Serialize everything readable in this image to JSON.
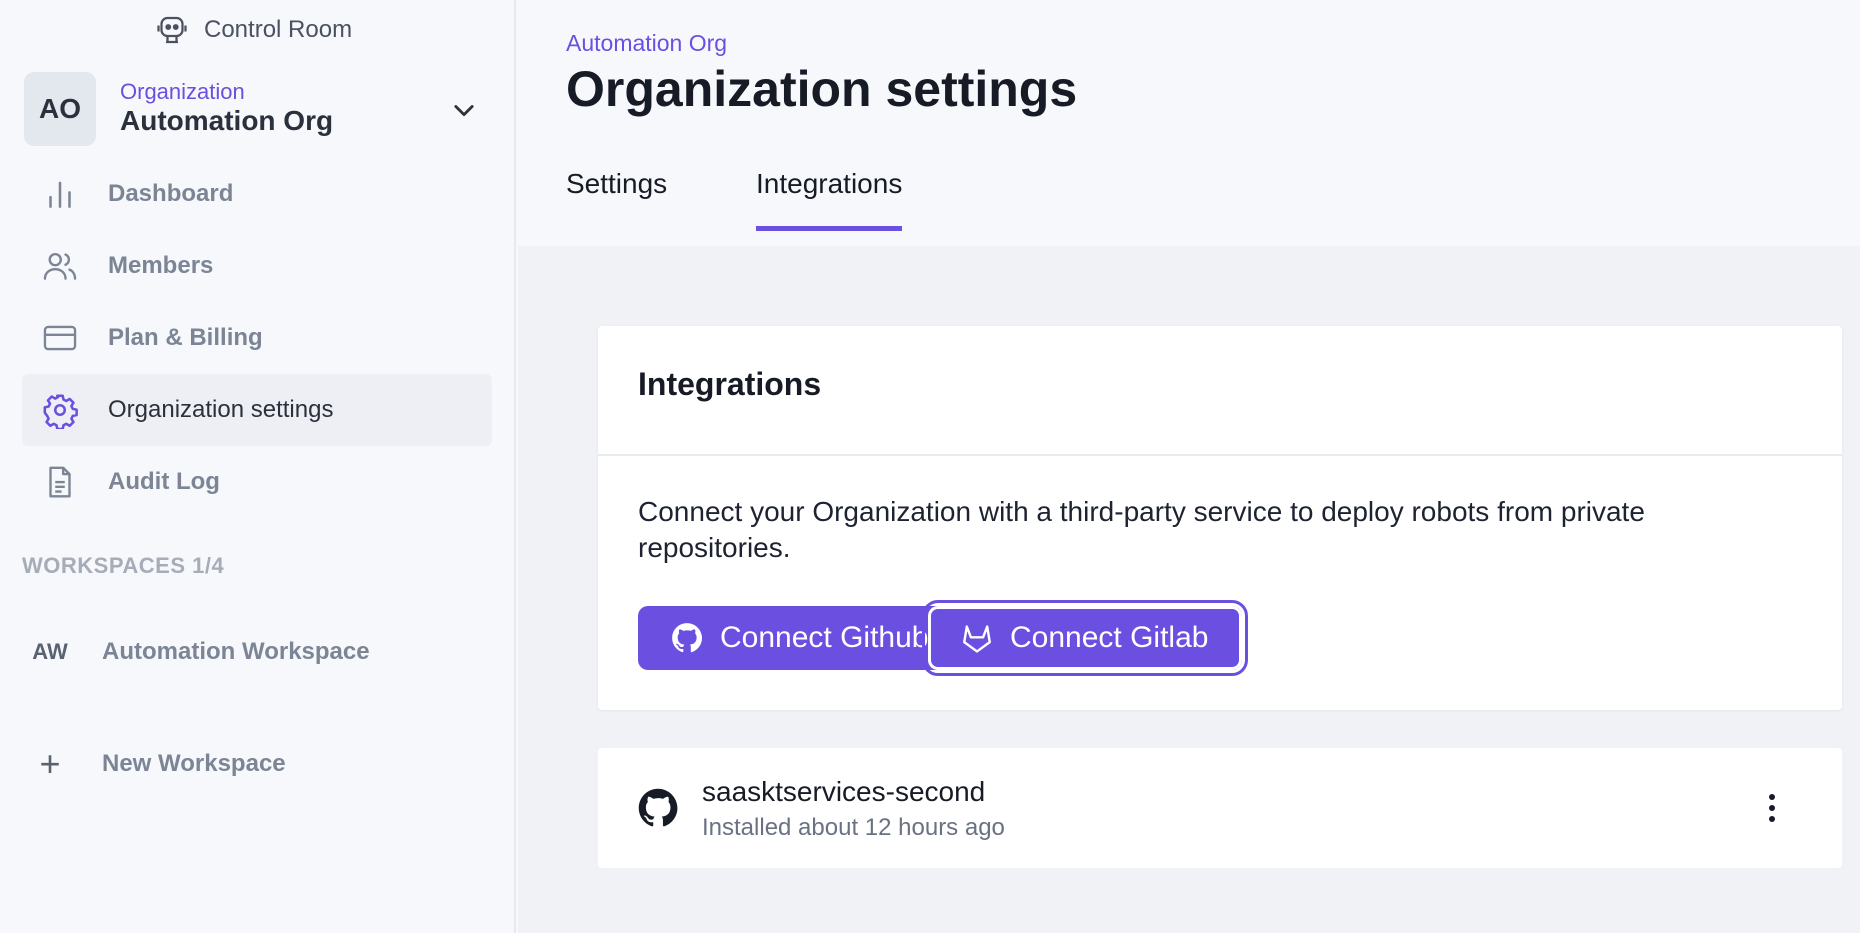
{
  "app": {
    "brand": "Control Room",
    "brand_icon": "robot-icon"
  },
  "org": {
    "avatar_initials": "AO",
    "kicker": "Organization",
    "name": "Automation Org"
  },
  "sidebar": {
    "items": [
      {
        "label": "Dashboard",
        "icon": "bar-chart-icon"
      },
      {
        "label": "Members",
        "icon": "users-icon"
      },
      {
        "label": "Plan & Billing",
        "icon": "credit-card-icon"
      },
      {
        "label": "Organization settings",
        "icon": "gear-icon"
      },
      {
        "label": "Audit Log",
        "icon": "document-icon"
      }
    ],
    "active_item": "Organization settings",
    "workspaces_title": "WORKSPACES 1/4",
    "workspaces": [
      {
        "abbr": "AW",
        "name": "Automation Workspace"
      }
    ],
    "new_workspace_label": "New Workspace"
  },
  "header": {
    "breadcrumb": "Automation Org",
    "title": "Organization settings",
    "tabs": [
      {
        "label": "Settings"
      },
      {
        "label": "Integrations"
      }
    ],
    "active_tab": "Integrations"
  },
  "integrations": {
    "title": "Integrations",
    "description": "Connect your Organization with a third-party service to deploy robots from private repositories.",
    "buttons": {
      "github": "Connect Github",
      "gitlab": "Connect Gitlab"
    },
    "connections": [
      {
        "name": "saasktservices-second",
        "status": "Installed about 12 hours ago",
        "icon": "github-icon"
      }
    ]
  },
  "colors": {
    "accent": "#6b4fe0",
    "text": "#161b26",
    "muted": "#7c8595"
  }
}
